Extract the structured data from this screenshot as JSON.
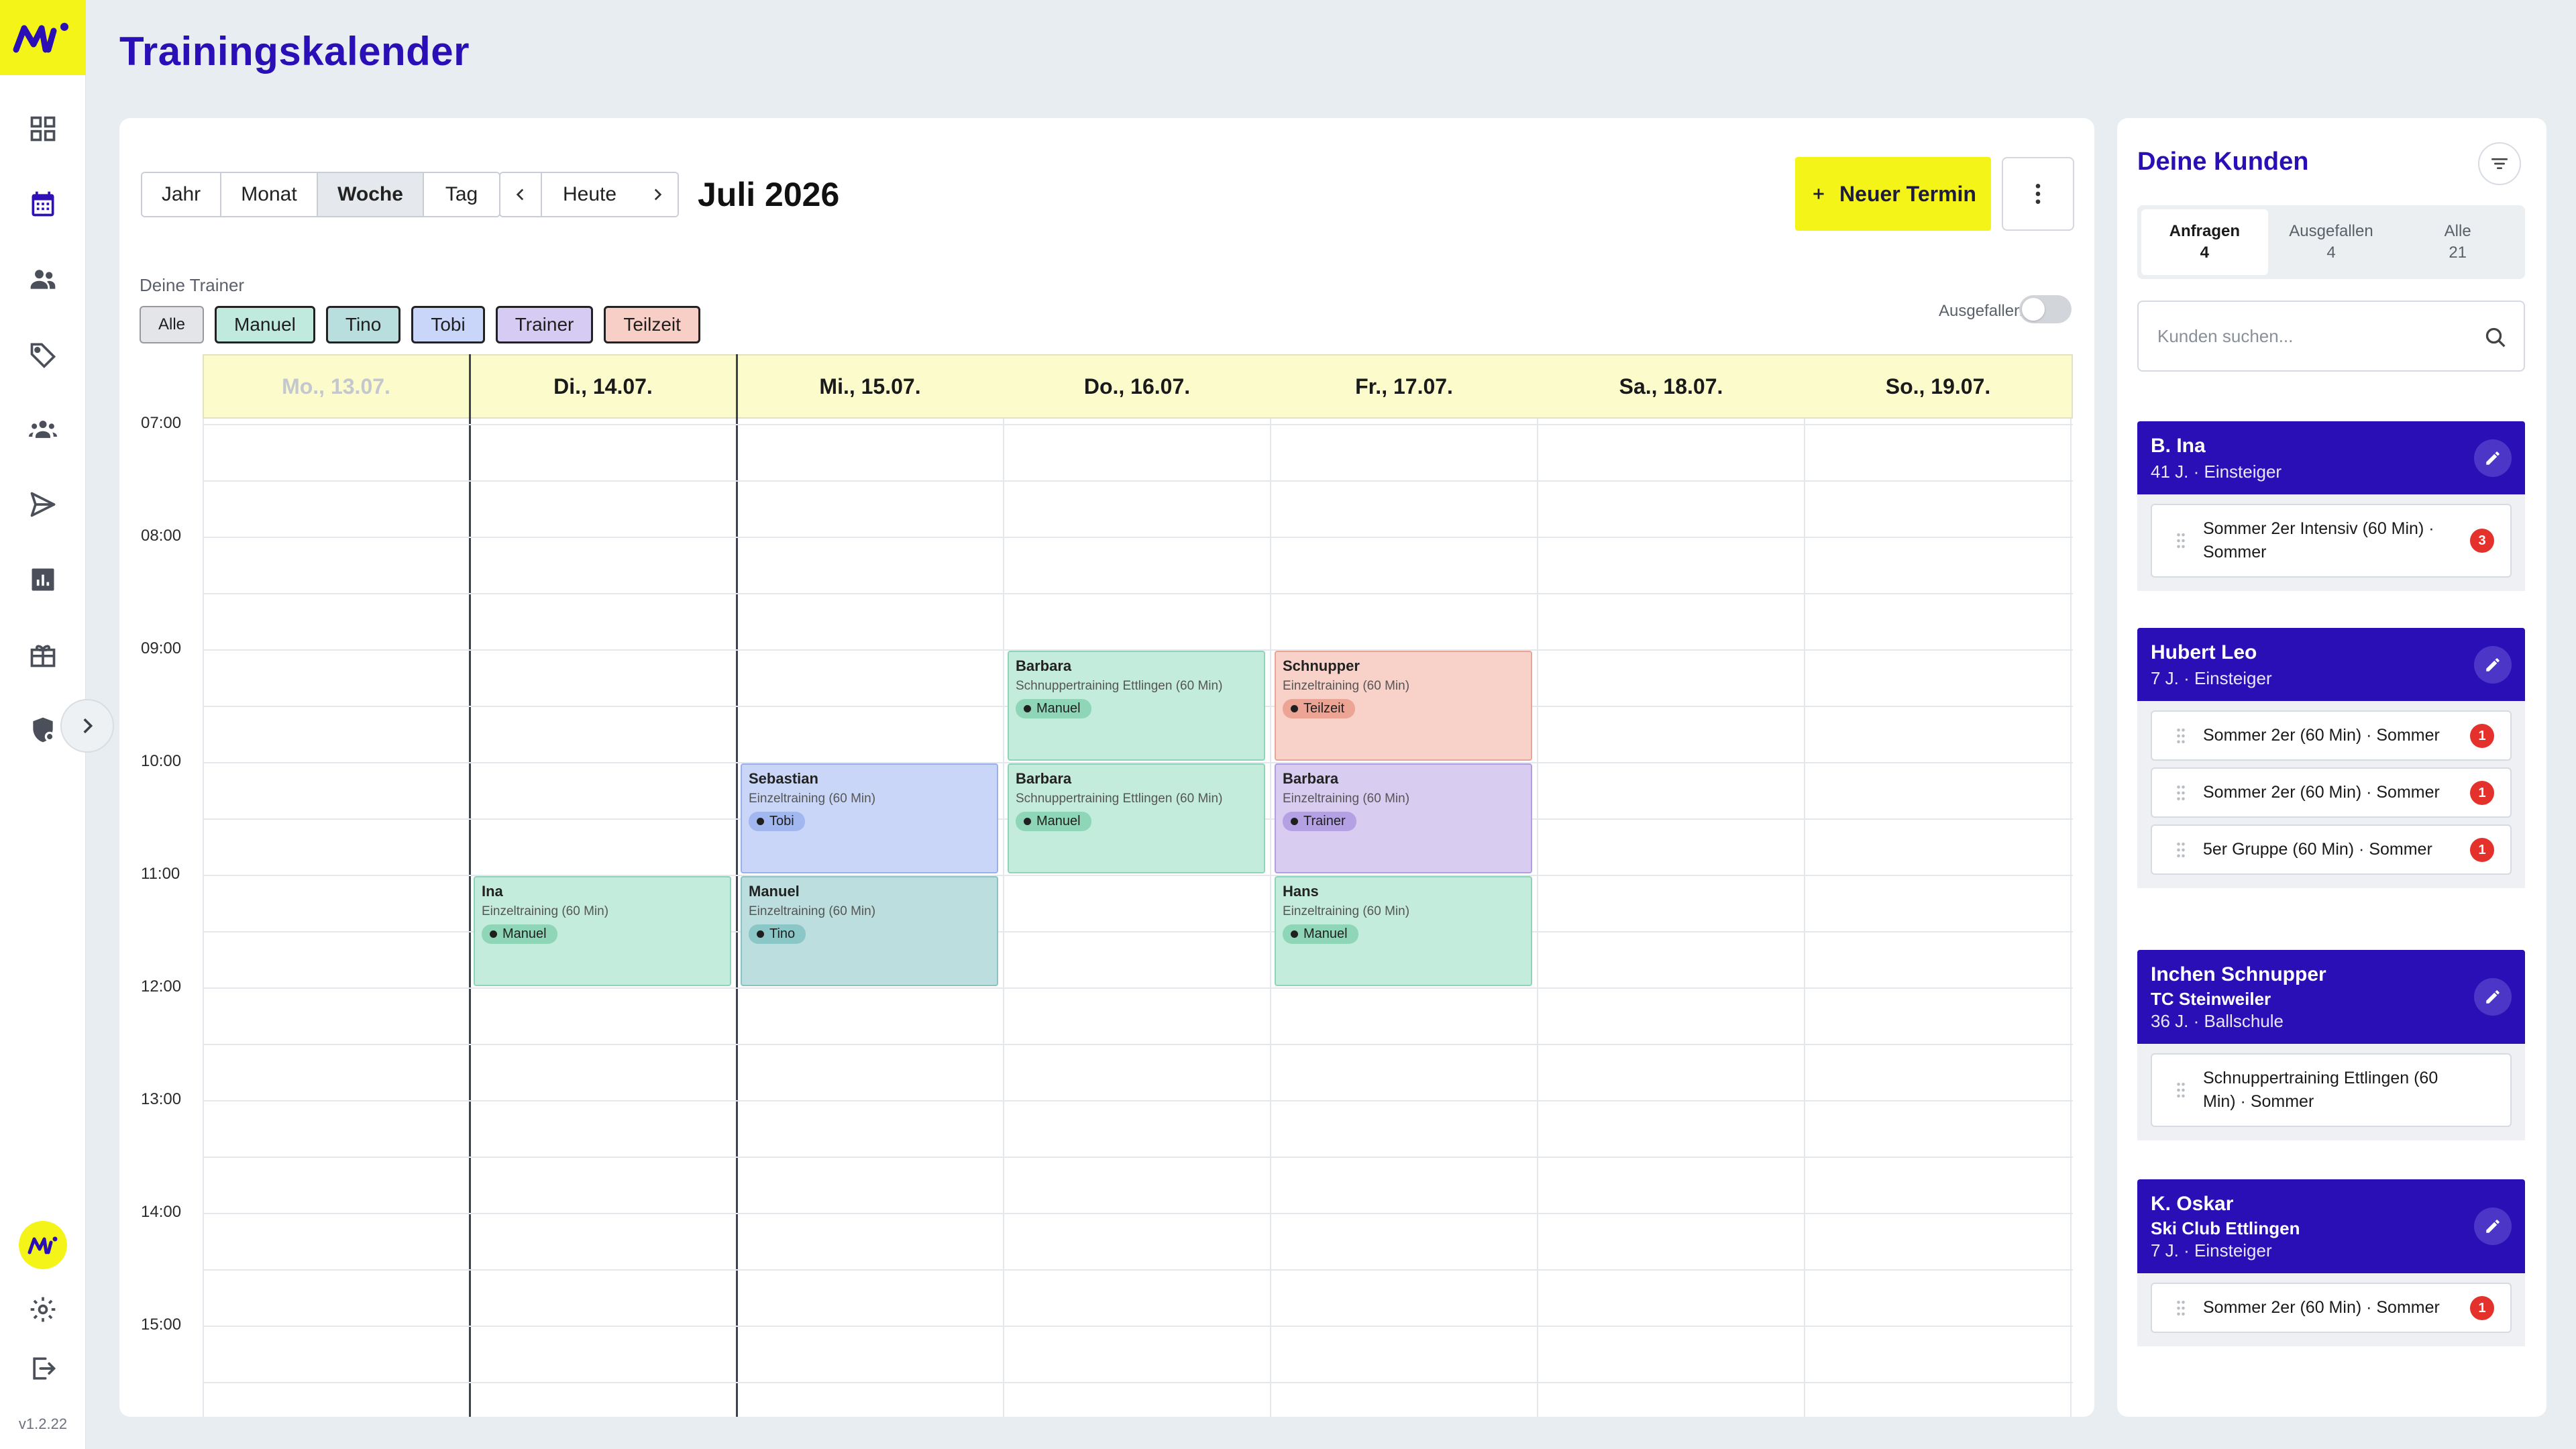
{
  "app": {
    "title": "Trainingskalender",
    "version": "v1.2.22"
  },
  "sidebar": {
    "items": [
      {
        "icon": "dashboard-icon"
      },
      {
        "icon": "calendar-icon",
        "active": true
      },
      {
        "icon": "users-icon"
      },
      {
        "icon": "tag-icon"
      },
      {
        "icon": "groups-icon"
      },
      {
        "icon": "send-icon"
      },
      {
        "icon": "chart-icon"
      },
      {
        "icon": "gift-icon"
      },
      {
        "icon": "shield-settings-icon"
      }
    ],
    "bottom": [
      {
        "icon": "settings-icon"
      },
      {
        "icon": "logout-icon"
      }
    ]
  },
  "toolbar": {
    "views": [
      "Jahr",
      "Monat",
      "Woche",
      "Tag"
    ],
    "active_view": "Woche",
    "today_label": "Heute",
    "month_label": "Juli 2026",
    "new_button": "Neuer Termin"
  },
  "trainers": {
    "label": "Deine Trainer",
    "chips": [
      {
        "label": "Alle",
        "color": "#e3e5e8"
      },
      {
        "label": "Manuel",
        "color": "#bfeadd"
      },
      {
        "label": "Tino",
        "color": "#b9dede"
      },
      {
        "label": "Tobi",
        "color": "#c9d6fa"
      },
      {
        "label": "Trainer",
        "color": "#d6cbf2"
      },
      {
        "label": "Teilzeit",
        "color": "#f8cfc6"
      }
    ],
    "toggle_label": "Ausgefallen"
  },
  "calendar": {
    "days": [
      "Mo., 13.07.",
      "Di., 14.07.",
      "Mi., 15.07.",
      "Do., 16.07.",
      "Fr., 17.07.",
      "Sa., 18.07.",
      "So., 19.07."
    ],
    "hours": [
      "07:00",
      "08:00",
      "09:00",
      "10:00",
      "11:00",
      "12:00",
      "13:00",
      "14:00",
      "15:00"
    ],
    "events": [
      {
        "day": 3,
        "start": 9,
        "name": "Barbara",
        "sub": "Schnuppertraining Ettlingen (60 Min)",
        "trainer": "Manuel",
        "bg": "#c4ecdd",
        "border": "#8fd3b8",
        "pill": "#8fd6b8"
      },
      {
        "day": 4,
        "start": 9,
        "name": "Schnupper",
        "sub": "Einzeltraining (60 Min)",
        "trainer": "Teilzeit",
        "bg": "#f8d2c9",
        "border": "#e7a596",
        "pill": "#eca595"
      },
      {
        "day": 2,
        "start": 10,
        "name": "Sebastian",
        "sub": "Einzeltraining (60 Min)",
        "trainer": "Tobi",
        "bg": "#c9d6f7",
        "border": "#9bb0ea",
        "pill": "#a2b6ef"
      },
      {
        "day": 3,
        "start": 10,
        "name": "Barbara",
        "sub": "Schnuppertraining Ettlingen (60 Min)",
        "trainer": "Manuel",
        "bg": "#c4ecdd",
        "border": "#8fd3b8",
        "pill": "#8fd6b8"
      },
      {
        "day": 4,
        "start": 10,
        "name": "Barbara",
        "sub": "Einzeltraining (60 Min)",
        "trainer": "Trainer",
        "bg": "#d8ccf1",
        "border": "#b19fe0",
        "pill": "#b4a1e3"
      },
      {
        "day": 1,
        "start": 11,
        "name": "Ina",
        "sub": "Einzeltraining (60 Min)",
        "trainer": "Manuel",
        "bg": "#c4ecdd",
        "border": "#8fd3b8",
        "pill": "#8fd6b8"
      },
      {
        "day": 2,
        "start": 11,
        "name": "Manuel",
        "sub": "Einzeltraining (60 Min)",
        "trainer": "Tino",
        "bg": "#bddede",
        "border": "#8ec2c2",
        "pill": "#8cc7c7"
      },
      {
        "day": 4,
        "start": 11,
        "name": "Hans",
        "sub": "Einzeltraining (60 Min)",
        "trainer": "Manuel",
        "bg": "#c4ecdd",
        "border": "#8fd3b8",
        "pill": "#8fd6b8"
      }
    ]
  },
  "customers": {
    "title": "Deine Kunden",
    "tabs": [
      {
        "label": "Anfragen",
        "count": "4",
        "active": true
      },
      {
        "label": "Ausgefallen",
        "count": "4"
      },
      {
        "label": "Alle",
        "count": "21"
      }
    ],
    "search_placeholder": "Kunden suchen...",
    "list": [
      {
        "name": "B. Ina",
        "club": "",
        "sub": "41 J. · Einsteiger",
        "bookings": [
          {
            "text": "Sommer 2er Intensiv (60 Min) · Sommer",
            "count": "3"
          }
        ]
      },
      {
        "name": "Hubert Leo",
        "club": "",
        "sub": "7 J. · Einsteiger",
        "bookings": [
          {
            "text": "Sommer 2er (60 Min) · Sommer",
            "count": "1"
          },
          {
            "text": "Sommer 2er (60 Min) · Sommer",
            "count": "1"
          },
          {
            "text": "5er Gruppe (60 Min) · Sommer",
            "count": "1"
          }
        ]
      },
      {
        "name": "Inchen Schnupper",
        "club": "TC Steinweiler",
        "sub": "36 J. · Ballschule",
        "bookings": [
          {
            "text": "Schnuppertraining Ettlingen (60 Min) · Sommer",
            "count": ""
          }
        ]
      },
      {
        "name": "K. Oskar",
        "club": "Ski Club Ettlingen",
        "sub": "7 J. · Einsteiger",
        "bookings": [
          {
            "text": "Sommer 2er (60 Min) · Sommer",
            "count": "1"
          }
        ]
      }
    ]
  }
}
